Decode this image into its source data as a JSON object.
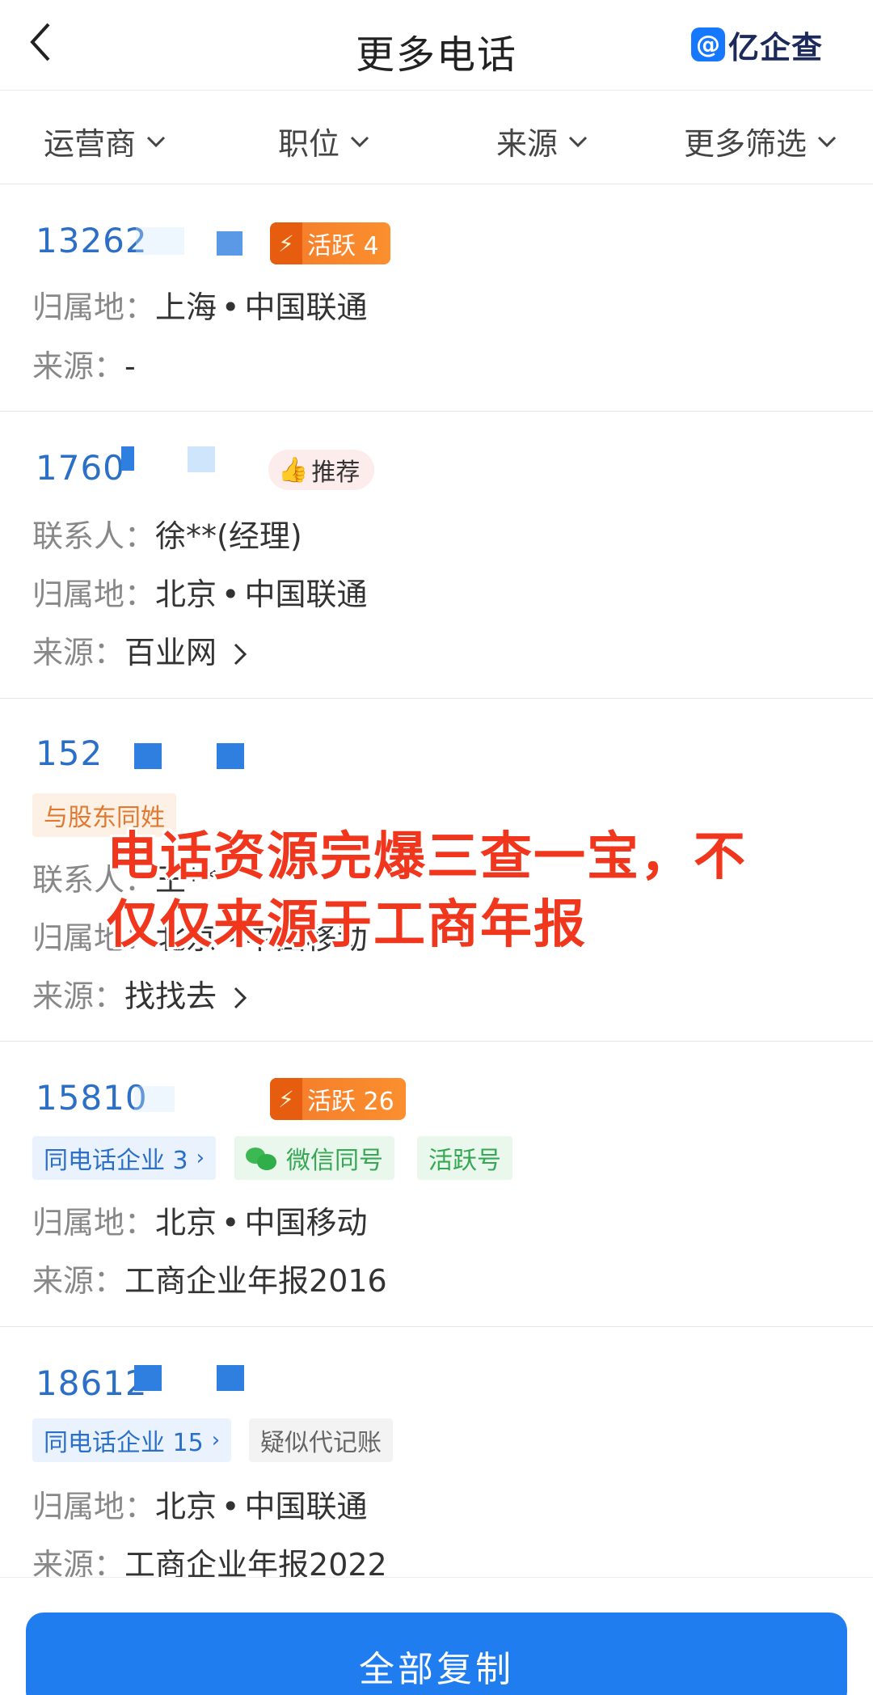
{
  "header": {
    "title": "更多电话",
    "brand_name": "亿企查",
    "brand_icon": "at-icon"
  },
  "filters": [
    {
      "label": "运营商"
    },
    {
      "label": "职位"
    },
    {
      "label": "来源"
    },
    {
      "label": "更多筛选"
    }
  ],
  "entries": [
    {
      "phone": "13262",
      "badge": "活跃 4",
      "region_label": "归属地：",
      "region": "上海",
      "carrier": "中国联通",
      "source_label": "来源：",
      "source": "-"
    },
    {
      "phone": "1760",
      "badge": "推荐",
      "contact_label": "联系人：",
      "contact": "徐**(经理)",
      "region_label": "归属地：",
      "region": "北京",
      "carrier": "中国联通",
      "source_label": "来源：",
      "source": "百业网"
    },
    {
      "phone": "152",
      "tag": "与股东同姓",
      "contact_label": "联系人：",
      "contact": "王**",
      "region_label": "归属地：",
      "region": "北京",
      "carrier": "中国移动",
      "source_label": "来源：",
      "source": "找找去"
    },
    {
      "phone": "15810",
      "badge": "活跃 26",
      "tags": [
        "同电话企业 3",
        "微信同号",
        "活跃号"
      ],
      "region_label": "归属地：",
      "region": "北京",
      "carrier": "中国移动",
      "source_label": "来源：",
      "source": "工商企业年报2016"
    },
    {
      "phone": "18612",
      "tags": [
        "同电话企业 15",
        "疑似代记账"
      ],
      "region_label": "归属地：",
      "region": "北京",
      "carrier": "中国联通",
      "source_label": "来源：",
      "source": "工商企业年报2022"
    }
  ],
  "overlay_text": "电话资源完爆三查一宝，不仅仅来源于工商年报",
  "copy_button": "全部复制",
  "colors": {
    "accent": "#1f7df0",
    "phone": "#2b6fc6",
    "overlay": "#f0371d",
    "active_badge": "#f47a2a"
  }
}
